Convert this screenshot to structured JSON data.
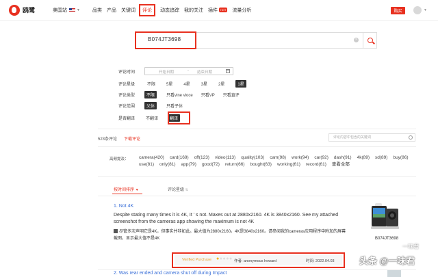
{
  "header": {
    "brand": "鸥鹭",
    "site": "美国站",
    "nav": [
      "品类",
      "产品",
      "关键词",
      "评论",
      "动态追踪",
      "我的关注",
      "插件",
      "流量分析"
    ],
    "hot_badge": "HOT",
    "buy_label": "购买"
  },
  "search": {
    "value": "B074JT3698"
  },
  "filters": {
    "time_label": "评论时间",
    "date_start_placeholder": "开始日期",
    "date_sep": "-",
    "date_end_placeholder": "结束日期",
    "star_label": "评论星级",
    "star_options": [
      "不限",
      "5星",
      "4星",
      "3星",
      "2星",
      "1星"
    ],
    "type_label": "评论类型",
    "type_options": [
      "不限",
      "只看vine vioce",
      "只看VP",
      "只看直评"
    ],
    "range_label": "评论范围",
    "range_options": [
      "父体",
      "只看子体"
    ],
    "flip_label": "是否翻译",
    "flip_options": [
      "不翻译",
      "翻译"
    ]
  },
  "results": {
    "count": "523条评论",
    "download": "下载评论",
    "review_search_placeholder": "评论内容中包含的关键词"
  },
  "keywords": {
    "label": "高频提及：",
    "items": [
      "camera(420)",
      "card(169)",
      "off(123)",
      "video(113)",
      "quality(103)",
      "cam(98)",
      "work(94)",
      "car(92)",
      "dash(91)",
      "4k(89)",
      "sd(89)",
      "buy(86)",
      "use(81)",
      "only(81)",
      "app(79)",
      "good(72)",
      "return(66)",
      "bought(63)",
      "working(61)",
      "record(61)"
    ],
    "all": "查看全部"
  },
  "sort": {
    "by_time": "按时间排序",
    "by_star": "评论星级"
  },
  "reviews": [
    {
      "title": "1. Not 4K",
      "body": "Despite stating many times it is 4K, It ' s not. Maxes out at 2880x2160. 4K is 3840x2160. See my attached screenshot from the cameras app showing the maximum is not 4K",
      "translation": "尽管多次声明它是4K，但事实并非如此。最大值为2880x2160。4K是3840x2160。请参阅我的cameras应用程序中附加的屏幕截图，显示最大值不是4K",
      "asin": "B074JT3698",
      "verified": "Verified Purchase",
      "rating": 1,
      "author": "作者: anonymous howard",
      "time": "时间: 2022.04.03"
    },
    {
      "title": "2. Was rear ended and camera shut off during Impact"
    }
  ],
  "watermark": "头条 @一味君",
  "watermark_logo": "一味君"
}
